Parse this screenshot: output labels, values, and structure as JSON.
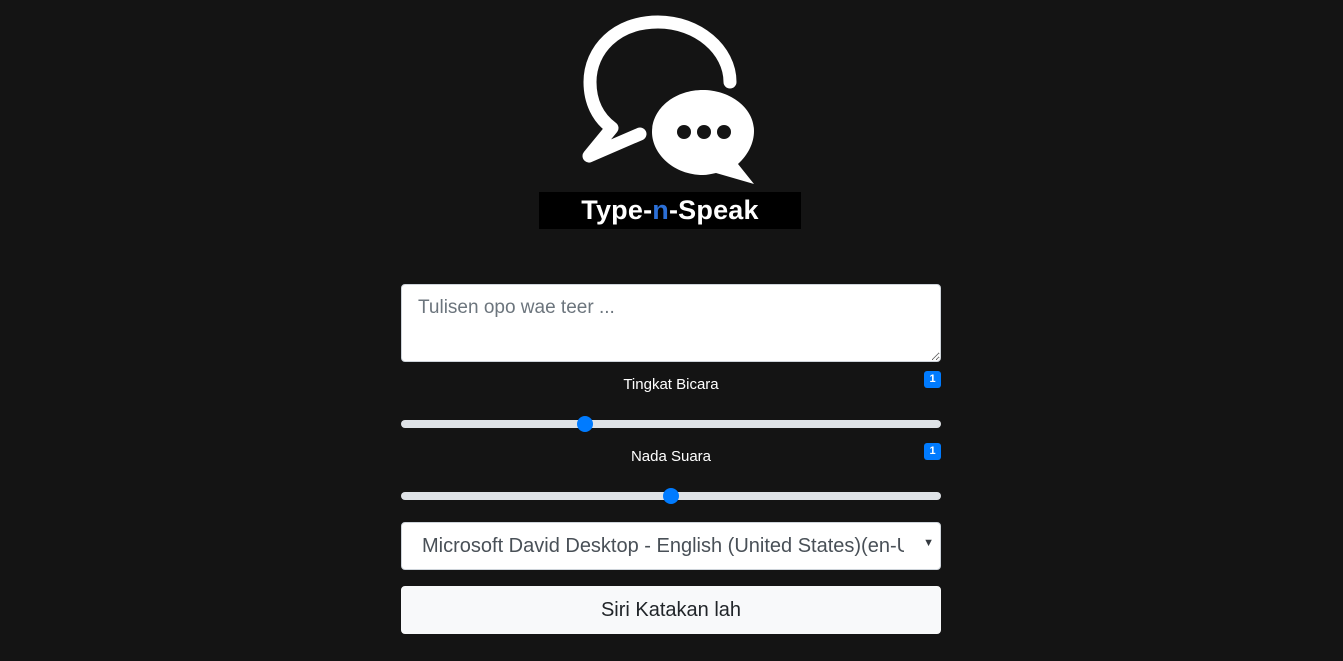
{
  "logo": {
    "text_before": "Type-",
    "text_accent": "n",
    "text_after": "-Speak",
    "icon": "chat-bubbles-icon",
    "accent_color": "#2b6fd6"
  },
  "textarea": {
    "placeholder": "Tulisen opo wae teer ...",
    "value": ""
  },
  "rate": {
    "label": "Tingkat Bicara",
    "badge": "1",
    "value_fraction": 0.34
  },
  "pitch": {
    "label": "Nada Suara",
    "badge": "1",
    "value_fraction": 0.5
  },
  "voice_select": {
    "selected": "Microsoft David Desktop - English (United States)(en-US)",
    "arrow_icon": "caret-down-icon"
  },
  "speak_button": {
    "label": "Siri Katakan lah"
  },
  "colors": {
    "background": "#141414",
    "primary": "#007bff",
    "button_bg": "#f8f9fa"
  }
}
